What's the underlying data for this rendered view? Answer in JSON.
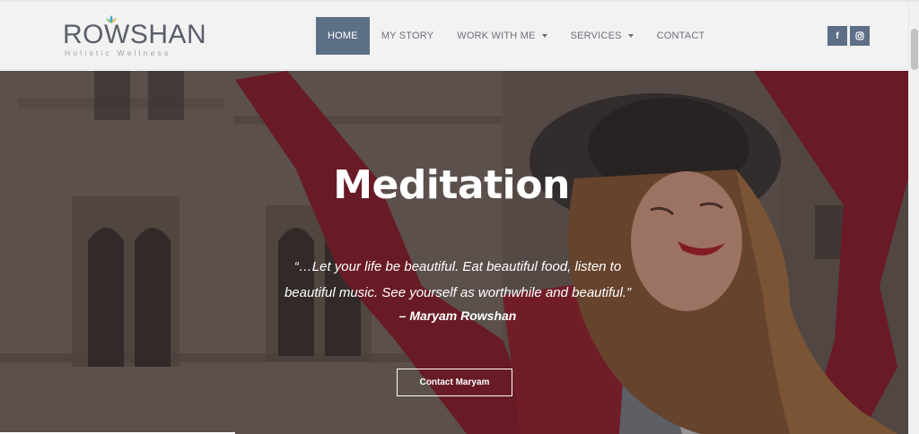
{
  "brand": {
    "name": "ROWSHAN",
    "tagline": "Holistic Wellness"
  },
  "nav": {
    "items": [
      {
        "label": "HOME",
        "active": true,
        "dropdown": false
      },
      {
        "label": "MY STORY",
        "active": false,
        "dropdown": false
      },
      {
        "label": "WORK WITH ME",
        "active": false,
        "dropdown": true
      },
      {
        "label": "SERVICES",
        "active": false,
        "dropdown": true
      },
      {
        "label": "CONTACT",
        "active": false,
        "dropdown": false
      }
    ]
  },
  "social": {
    "facebook_glyph": "f",
    "instagram_icon": "instagram-icon",
    "accent_color": "#5d6f86"
  },
  "hero": {
    "title": "Meditation",
    "quote_line1": "“…Let your life be beautiful.  Eat beautiful food, listen to",
    "quote_line2": "beautiful music. See yourself as worthwhile and beautiful.”",
    "author": "– Maryam Rowshan",
    "cta_label": "Contact Maryam"
  }
}
